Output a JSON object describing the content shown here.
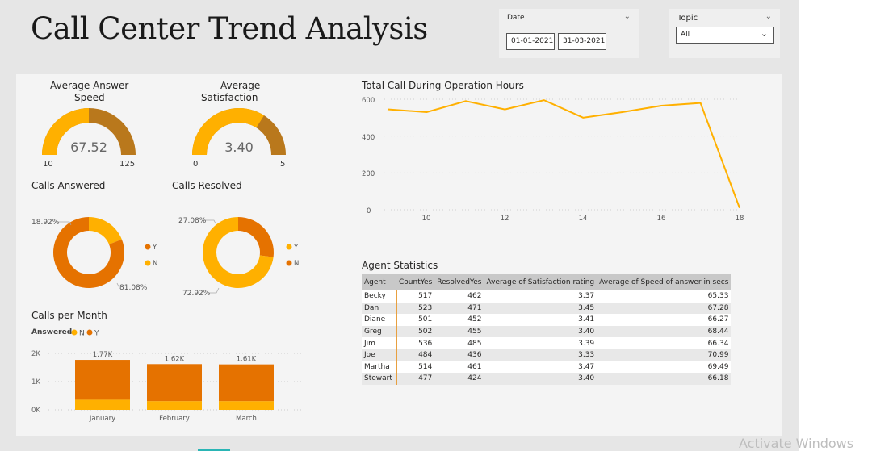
{
  "header": {
    "title": "Call Center Trend Analysis"
  },
  "filters": {
    "date": {
      "label": "Date",
      "start": "01-01-2021",
      "end": "31-03-2021"
    },
    "topic": {
      "label": "Topic",
      "selected": "All"
    }
  },
  "gauges": [
    {
      "title_line1": "Average Answer",
      "title_line2": "Speed",
      "value": 67.52,
      "value_label": "67.52",
      "min_label": "10",
      "max_label": "125",
      "min": 10,
      "max": 125
    },
    {
      "title_line1": "Average",
      "title_line2": "Satisfaction",
      "value": 3.4,
      "value_label": "3.40",
      "min_label": "0",
      "max_label": "5",
      "min": 0,
      "max": 5
    }
  ],
  "donuts": [
    {
      "title": "Calls Answered",
      "legend": [
        "Y",
        "N"
      ],
      "label_small": "18.92%",
      "label_large": "81.08%"
    },
    {
      "title": "Calls Resolved",
      "legend": [
        "Y",
        "N"
      ],
      "label_small": "27.08%",
      "label_large": "72.92%"
    }
  ],
  "calls_per_month": {
    "title": "Calls per Month",
    "legend_title": "Answered",
    "legend": [
      "N",
      "Y"
    ],
    "y_ticks": [
      "2K",
      "1K",
      "0K"
    ]
  },
  "line_chart": {
    "title": "Total Call During Operation Hours",
    "y_ticks": [
      "600",
      "400",
      "200",
      "0"
    ],
    "x_ticks": [
      "10",
      "12",
      "14",
      "16",
      "18"
    ]
  },
  "agent_stats": {
    "title": "Agent Statistics",
    "columns": [
      "Agent",
      "CountYes",
      "ResolvedYes",
      "Average of Satisfaction rating",
      "Average of Speed of answer in secs"
    ],
    "rows": [
      [
        "Becky",
        "517",
        "462",
        "3.37",
        "65.33"
      ],
      [
        "Dan",
        "523",
        "471",
        "3.45",
        "67.28"
      ],
      [
        "Diane",
        "501",
        "452",
        "3.41",
        "66.27"
      ],
      [
        "Greg",
        "502",
        "455",
        "3.40",
        "68.44"
      ],
      [
        "Jim",
        "536",
        "485",
        "3.39",
        "66.34"
      ],
      [
        "Joe",
        "484",
        "436",
        "3.33",
        "70.99"
      ],
      [
        "Martha",
        "514",
        "461",
        "3.47",
        "69.49"
      ],
      [
        "Stewart",
        "477",
        "424",
        "3.40",
        "66.18"
      ]
    ]
  },
  "colors": {
    "yellow": "#FFB000",
    "orange": "#E57200",
    "brown": "#B9781C"
  },
  "watermark": "Activate Windows",
  "chart_data": [
    {
      "type": "pie",
      "title": "Calls Answered",
      "categories": [
        "Y",
        "N"
      ],
      "values": [
        81.08,
        18.92
      ]
    },
    {
      "type": "pie",
      "title": "Calls Resolved",
      "categories": [
        "Y",
        "N"
      ],
      "values": [
        27.08,
        72.92
      ]
    },
    {
      "type": "bar",
      "title": "Calls per Month",
      "categories": [
        "January",
        "February",
        "March"
      ],
      "totals": [
        "1.77K",
        "1.62K",
        "1.61K"
      ],
      "series": [
        {
          "name": "N",
          "values": [
            0.36,
            0.31,
            0.31
          ]
        },
        {
          "name": "Y",
          "values": [
            1.41,
            1.31,
            1.3
          ]
        }
      ],
      "ylabel": "",
      "ylim": [
        0,
        2
      ]
    },
    {
      "type": "line",
      "title": "Total Call During Operation Hours",
      "x": [
        9,
        10,
        11,
        12,
        13,
        14,
        15,
        16,
        17,
        18
      ],
      "y": [
        545,
        530,
        590,
        545,
        595,
        500,
        530,
        565,
        580,
        10
      ],
      "xlim": [
        9,
        18
      ],
      "ylim": [
        0,
        620
      ],
      "grid": true
    }
  ]
}
